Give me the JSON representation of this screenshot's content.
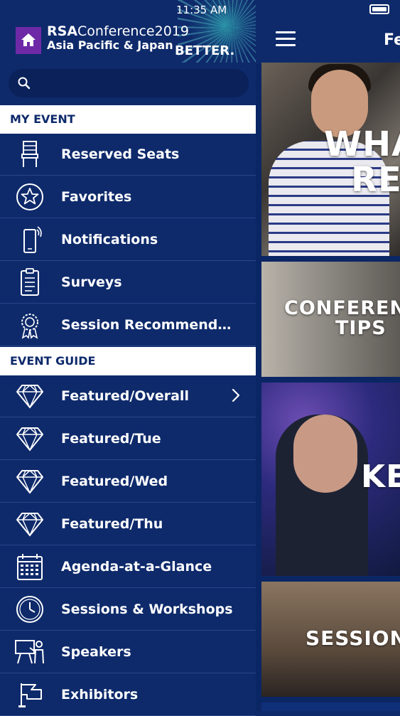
{
  "status_bar": {
    "time": "11:35 AM"
  },
  "brand": {
    "rsa": "RSA",
    "conference": "Conference2019",
    "region": "Asia Pacific & Japan",
    "tagline": "BETTER."
  },
  "search": {
    "placeholder": ""
  },
  "sections": [
    {
      "title": "MY EVENT",
      "items": [
        {
          "label": "Reserved Seats",
          "icon": "chair-icon"
        },
        {
          "label": "Favorites",
          "icon": "star-icon"
        },
        {
          "label": "Notifications",
          "icon": "phone-notification-icon"
        },
        {
          "label": "Surveys",
          "icon": "clipboard-icon"
        },
        {
          "label": "Session Recommendat...",
          "icon": "award-icon"
        }
      ]
    },
    {
      "title": "EVENT GUIDE",
      "items": [
        {
          "label": "Featured/Overall",
          "icon": "diamond-icon",
          "has_chevron": true
        },
        {
          "label": "Featured/Tue",
          "icon": "diamond-icon"
        },
        {
          "label": "Featured/Wed",
          "icon": "diamond-icon"
        },
        {
          "label": "Featured/Thu",
          "icon": "diamond-icon"
        },
        {
          "label": "Agenda-at-a-Glance",
          "icon": "calendar-icon"
        },
        {
          "label": "Sessions & Workshops",
          "icon": "clock-icon"
        },
        {
          "label": "Speakers",
          "icon": "speaker-icon"
        },
        {
          "label": "Exhibitors",
          "icon": "flag-icon"
        }
      ]
    }
  ],
  "content": {
    "title": "Fe",
    "tiles": [
      {
        "label_line1": "WHA",
        "label_line2": "RE"
      },
      {
        "label_line1": "CONFEREN",
        "label_line2": "TIPS"
      },
      {
        "label_line1": "KE"
      },
      {
        "label_line1": "SESSION"
      }
    ]
  },
  "colors": {
    "navy": "#0e2a6b",
    "purple": "#6e2aa6",
    "white": "#ffffff"
  }
}
